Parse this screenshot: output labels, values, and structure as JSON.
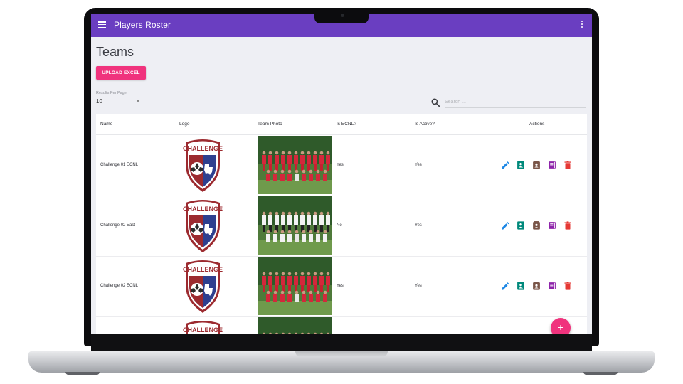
{
  "appbar": {
    "title": "Players Roster"
  },
  "page": {
    "title": "Teams",
    "upload_label": "UPLOAD EXCEL"
  },
  "controls": {
    "results_label": "Results Per Page",
    "results_value": "10",
    "search_placeholder": "Search ..."
  },
  "table": {
    "headers": [
      "Name",
      "Logo",
      "Team Photo",
      "Is ECNL?",
      "Is Active?",
      "Actions"
    ],
    "rows": [
      {
        "name": "Challenge 01 ECNL",
        "is_ecnl": "Yes",
        "is_active": "Yes"
      },
      {
        "name": "Challenge 02 East",
        "is_ecnl": "No",
        "is_active": "Yes"
      },
      {
        "name": "Challenge 02 ECNL",
        "is_ecnl": "Yes",
        "is_active": "Yes"
      },
      {
        "name": "",
        "is_ecnl": "",
        "is_active": ""
      }
    ],
    "action_icons": [
      "edit-icon",
      "player-card-icon",
      "roster-icon",
      "book-icon",
      "delete-icon"
    ],
    "logo_text": "CHALLENGE"
  },
  "fab": {
    "label": "+"
  },
  "colors": {
    "appbar": "#6a3ec1",
    "accent": "#f0337d",
    "edit": "#1e88e5",
    "player_card": "#00897b",
    "roster": "#795548",
    "book": "#8e24aa",
    "delete": "#e53935",
    "logo_red": "#9c2a2f",
    "logo_blue": "#2e3f8f"
  }
}
